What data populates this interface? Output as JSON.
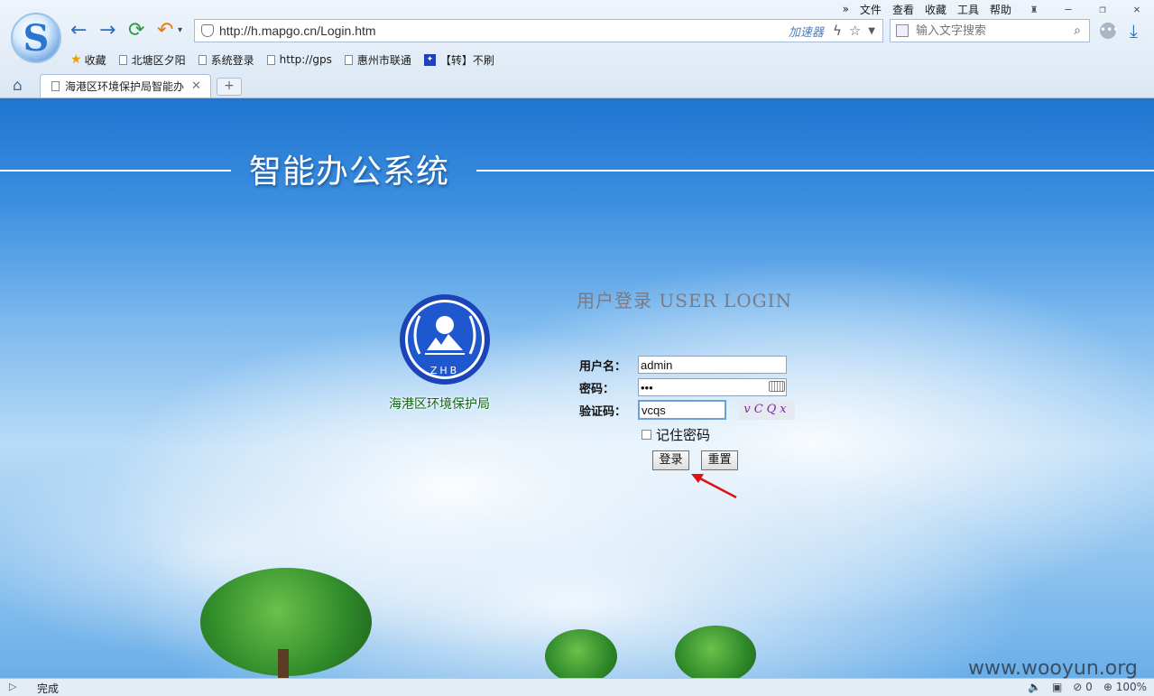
{
  "browser": {
    "menu": [
      "文件",
      "查看",
      "收藏",
      "工具",
      "帮助"
    ],
    "url": "http://h.mapgo.cn/Login.htm",
    "accelerator_label": "加速器",
    "search_placeholder": "输入文字搜索",
    "bookmarks": [
      {
        "label": "收藏",
        "icon": "star-icon"
      },
      {
        "label": "北塘区夕阳",
        "icon": "page-icon"
      },
      {
        "label": "系统登录",
        "icon": "page-icon"
      },
      {
        "label": "http://gps",
        "icon": "page-icon"
      },
      {
        "label": "惠州市联通",
        "icon": "page-icon"
      },
      {
        "label": "【转】不刷",
        "icon": "paw-icon"
      }
    ],
    "tab_title": "海港区环境保护局智能办",
    "status_text": "完成",
    "zoom": "100%",
    "block_count": "0"
  },
  "page": {
    "system_title": "智能办公系统",
    "org_name": "海港区环境保护局",
    "emblem_text": "ZHB",
    "login_title": "用户登录 USER LOGIN",
    "username_label": "用户名：",
    "username_value": "admin",
    "password_label": "密码：",
    "password_value": "•••",
    "captcha_label": "验证码：",
    "captcha_value": "vcqs",
    "captcha_image_text": "vCQx",
    "remember_label": "记住密码",
    "login_button": "登录",
    "reset_button": "重置"
  },
  "watermark": "www.wooyun.org",
  "colors": {
    "accent": "#2b6fbf",
    "sky_top": "#1f74d0",
    "org_green": "#0c6a12",
    "arrow_red": "#e01010"
  }
}
